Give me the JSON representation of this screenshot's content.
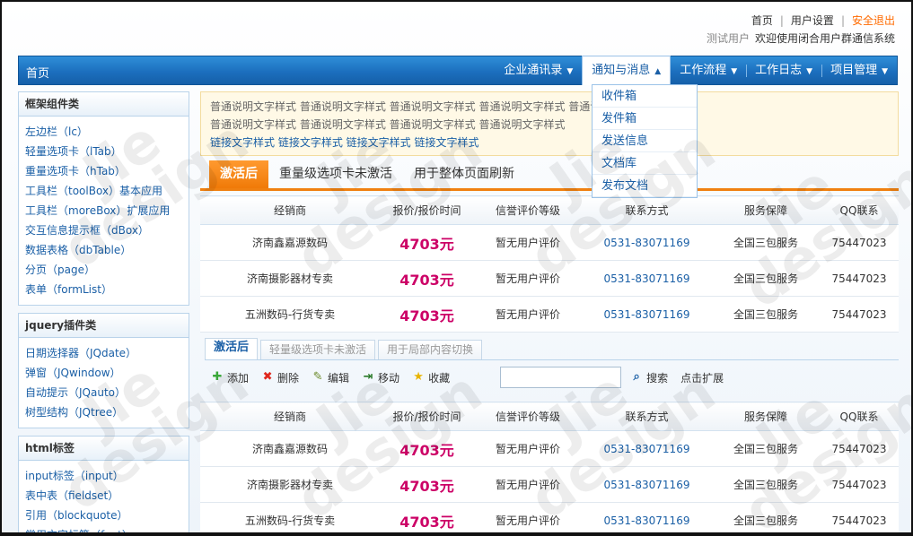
{
  "top_links": {
    "home": "首页",
    "settings": "用户设置",
    "logout": "安全退出"
  },
  "welcome": {
    "user": "测试用户",
    "message": "欢迎使用闭合用户群通信系统"
  },
  "nav": {
    "home": "首页",
    "items": [
      {
        "label": "企业通讯录"
      },
      {
        "label": "通知与消息"
      },
      {
        "label": "工作流程"
      },
      {
        "label": "工作日志"
      },
      {
        "label": "项目管理"
      }
    ]
  },
  "dropdown": [
    "收件箱",
    "发件箱",
    "发送信息",
    "文档库",
    "发布文档"
  ],
  "sidebar": [
    {
      "title": "框架组件类",
      "items": [
        "左边栏（lc）",
        "轻量选项卡（lTab）",
        "重量选项卡（hTab）",
        "工具栏（toolBox）基本应用",
        "工具栏（moreBox）扩展应用",
        "交互信息提示框（dBox）",
        "数据表格（dbTable）",
        "分页（page）",
        "表单（formList）"
      ]
    },
    {
      "title": "jquery插件类",
      "items": [
        "日期选择器（JQdate）",
        "弹窗（JQwindow）",
        "自动提示（JQauto）",
        "树型结构（JQtree）"
      ]
    },
    {
      "title": "html标签",
      "items": [
        "input标签（input）",
        "表中表（fieldset）",
        "引用（blockquote）",
        "常用文字标签（font）"
      ]
    }
  ],
  "notice": {
    "lines": [
      "普通说明文字样式 普通说明文字样式 普通说明文字样式 普通说明文字样式 普通说明文字样式",
      "普通说明文字样式 普通说明文字样式 普通说明文字样式 普通说明文字样式"
    ],
    "links": "链接文字样式 链接文字样式 链接文字样式 链接文字样式"
  },
  "tabs_heavy": [
    "激活后",
    "重量级选项卡未激活",
    "用于整体页面刷新"
  ],
  "tabs_light": [
    "激活后",
    "轻量级选项卡未激活",
    "用于局部内容切换"
  ],
  "table": {
    "headers": [
      "经销商",
      "报价/报价时间",
      "信誉评价等级",
      "联系方式",
      "服务保障",
      "QQ联系"
    ],
    "rows": [
      [
        "济南鑫嘉源数码",
        "4703元",
        "暂无用户评价",
        "0531-83071169",
        "全国三包服务",
        "75447023"
      ],
      [
        "济南摄影器材专卖",
        "4703元",
        "暂无用户评价",
        "0531-83071169",
        "全国三包服务",
        "75447023"
      ],
      [
        "五洲数码-行货专卖",
        "4703元",
        "暂无用户评价",
        "0531-83071169",
        "全国三包服务",
        "75447023"
      ]
    ]
  },
  "toolbar": {
    "add": "添加",
    "delete": "删除",
    "edit": "编辑",
    "move": "移动",
    "favorite": "收藏",
    "search": "搜索",
    "expand": "点击扩展"
  },
  "watermark": "Jie design"
}
